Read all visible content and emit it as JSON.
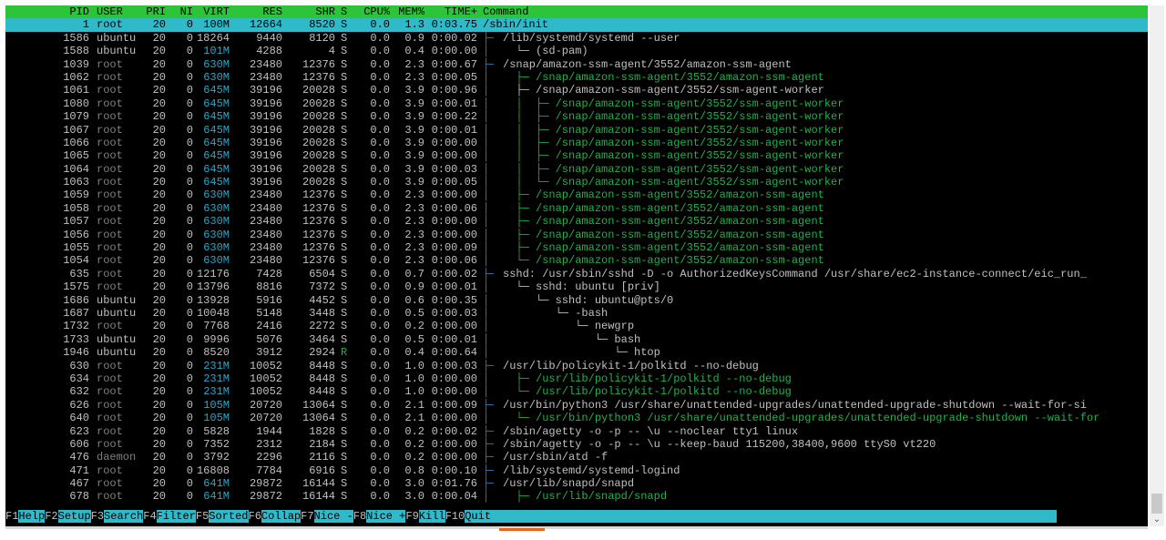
{
  "header": {
    "pid": "PID",
    "user": "USER",
    "pri": "PRI",
    "ni": "NI",
    "virt": "VIRT",
    "res": "RES",
    "shr": "SHR",
    "s": "S",
    "cpu": "CPU%",
    "mem": "MEM%",
    "time": "TIME+",
    "command": "Command"
  },
  "processes": [
    {
      "pid": "1",
      "user": "root",
      "pri": "20",
      "ni": "0",
      "virt": "100M",
      "res": "12664",
      "shr": "8520",
      "s": "S",
      "cpu": "0.0",
      "mem": "1.3",
      "time": "0:03.75",
      "tree": "",
      "command": "/sbin/init",
      "selected": true
    },
    {
      "pid": "1586",
      "user": "ubuntu",
      "pri": "20",
      "ni": "0",
      "virt": "18264",
      "res": "9440",
      "shr": "8120",
      "s": "S",
      "cpu": "0.0",
      "mem": "0.9",
      "time": "0:00.02",
      "tree": "├─",
      "command": "/lib/systemd/systemd --user"
    },
    {
      "pid": "1588",
      "user": "ubuntu",
      "pri": "20",
      "ni": "0",
      "virt": "101M",
      "res": "4288",
      "shr": "4",
      "s": "S",
      "cpu": "0.0",
      "mem": "0.4",
      "time": "0:00.00",
      "tree": "│",
      "command": "  └─ (sd-pam)"
    },
    {
      "pid": "1039",
      "user": "root",
      "pri": "20",
      "ni": "0",
      "virt": "630M",
      "res": "23480",
      "shr": "12376",
      "s": "S",
      "cpu": "0.0",
      "mem": "2.3",
      "time": "0:00.67",
      "tree": "├─",
      "command": "/snap/amazon-ssm-agent/3552/amazon-ssm-agent"
    },
    {
      "pid": "1062",
      "user": "root",
      "pri": "20",
      "ni": "0",
      "virt": "630M",
      "res": "23480",
      "shr": "12376",
      "s": "S",
      "cpu": "0.0",
      "mem": "2.3",
      "time": "0:00.05",
      "tree": "│",
      "command": "  ├─ /snap/amazon-ssm-agent/3552/amazon-ssm-agent",
      "thread": true
    },
    {
      "pid": "1061",
      "user": "root",
      "pri": "20",
      "ni": "0",
      "virt": "645M",
      "res": "39196",
      "shr": "20028",
      "s": "S",
      "cpu": "0.0",
      "mem": "3.9",
      "time": "0:00.96",
      "tree": "│",
      "command": "  ├─ /snap/amazon-ssm-agent/3552/ssm-agent-worker"
    },
    {
      "pid": "1080",
      "user": "root",
      "pri": "20",
      "ni": "0",
      "virt": "645M",
      "res": "39196",
      "shr": "20028",
      "s": "S",
      "cpu": "0.0",
      "mem": "3.9",
      "time": "0:00.01",
      "tree": "│",
      "command": "  │  ├─ /snap/amazon-ssm-agent/3552/ssm-agent-worker",
      "thread": true
    },
    {
      "pid": "1079",
      "user": "root",
      "pri": "20",
      "ni": "0",
      "virt": "645M",
      "res": "39196",
      "shr": "20028",
      "s": "S",
      "cpu": "0.0",
      "mem": "3.9",
      "time": "0:00.22",
      "tree": "│",
      "command": "  │  ├─ /snap/amazon-ssm-agent/3552/ssm-agent-worker",
      "thread": true
    },
    {
      "pid": "1067",
      "user": "root",
      "pri": "20",
      "ni": "0",
      "virt": "645M",
      "res": "39196",
      "shr": "20028",
      "s": "S",
      "cpu": "0.0",
      "mem": "3.9",
      "time": "0:00.01",
      "tree": "│",
      "command": "  │  ├─ /snap/amazon-ssm-agent/3552/ssm-agent-worker",
      "thread": true
    },
    {
      "pid": "1066",
      "user": "root",
      "pri": "20",
      "ni": "0",
      "virt": "645M",
      "res": "39196",
      "shr": "20028",
      "s": "S",
      "cpu": "0.0",
      "mem": "3.9",
      "time": "0:00.00",
      "tree": "│",
      "command": "  │  ├─ /snap/amazon-ssm-agent/3552/ssm-agent-worker",
      "thread": true
    },
    {
      "pid": "1065",
      "user": "root",
      "pri": "20",
      "ni": "0",
      "virt": "645M",
      "res": "39196",
      "shr": "20028",
      "s": "S",
      "cpu": "0.0",
      "mem": "3.9",
      "time": "0:00.00",
      "tree": "│",
      "command": "  │  ├─ /snap/amazon-ssm-agent/3552/ssm-agent-worker",
      "thread": true
    },
    {
      "pid": "1064",
      "user": "root",
      "pri": "20",
      "ni": "0",
      "virt": "645M",
      "res": "39196",
      "shr": "20028",
      "s": "S",
      "cpu": "0.0",
      "mem": "3.9",
      "time": "0:00.03",
      "tree": "│",
      "command": "  │  ├─ /snap/amazon-ssm-agent/3552/ssm-agent-worker",
      "thread": true
    },
    {
      "pid": "1063",
      "user": "root",
      "pri": "20",
      "ni": "0",
      "virt": "645M",
      "res": "39196",
      "shr": "20028",
      "s": "S",
      "cpu": "0.0",
      "mem": "3.9",
      "time": "0:00.05",
      "tree": "│",
      "command": "  │  └─ /snap/amazon-ssm-agent/3552/ssm-agent-worker",
      "thread": true
    },
    {
      "pid": "1059",
      "user": "root",
      "pri": "20",
      "ni": "0",
      "virt": "630M",
      "res": "23480",
      "shr": "12376",
      "s": "S",
      "cpu": "0.0",
      "mem": "2.3",
      "time": "0:00.00",
      "tree": "│",
      "command": "  ├─ /snap/amazon-ssm-agent/3552/amazon-ssm-agent",
      "thread": true
    },
    {
      "pid": "1058",
      "user": "root",
      "pri": "20",
      "ni": "0",
      "virt": "630M",
      "res": "23480",
      "shr": "12376",
      "s": "S",
      "cpu": "0.0",
      "mem": "2.3",
      "time": "0:00.06",
      "tree": "│",
      "command": "  ├─ /snap/amazon-ssm-agent/3552/amazon-ssm-agent",
      "thread": true
    },
    {
      "pid": "1057",
      "user": "root",
      "pri": "20",
      "ni": "0",
      "virt": "630M",
      "res": "23480",
      "shr": "12376",
      "s": "S",
      "cpu": "0.0",
      "mem": "2.3",
      "time": "0:00.00",
      "tree": "│",
      "command": "  ├─ /snap/amazon-ssm-agent/3552/amazon-ssm-agent",
      "thread": true
    },
    {
      "pid": "1056",
      "user": "root",
      "pri": "20",
      "ni": "0",
      "virt": "630M",
      "res": "23480",
      "shr": "12376",
      "s": "S",
      "cpu": "0.0",
      "mem": "2.3",
      "time": "0:00.00",
      "tree": "│",
      "command": "  ├─ /snap/amazon-ssm-agent/3552/amazon-ssm-agent",
      "thread": true
    },
    {
      "pid": "1055",
      "user": "root",
      "pri": "20",
      "ni": "0",
      "virt": "630M",
      "res": "23480",
      "shr": "12376",
      "s": "S",
      "cpu": "0.0",
      "mem": "2.3",
      "time": "0:00.09",
      "tree": "│",
      "command": "  ├─ /snap/amazon-ssm-agent/3552/amazon-ssm-agent",
      "thread": true
    },
    {
      "pid": "1054",
      "user": "root",
      "pri": "20",
      "ni": "0",
      "virt": "630M",
      "res": "23480",
      "shr": "12376",
      "s": "S",
      "cpu": "0.0",
      "mem": "2.3",
      "time": "0:00.06",
      "tree": "│",
      "command": "  └─ /snap/amazon-ssm-agent/3552/amazon-ssm-agent",
      "thread": true
    },
    {
      "pid": "635",
      "user": "root",
      "pri": "20",
      "ni": "0",
      "virt": "12176",
      "res": "7428",
      "shr": "6504",
      "s": "S",
      "cpu": "0.0",
      "mem": "0.7",
      "time": "0:00.02",
      "tree": "├─",
      "command": "sshd: /usr/sbin/sshd -D -o AuthorizedKeysCommand /usr/share/ec2-instance-connect/eic_run_"
    },
    {
      "pid": "1575",
      "user": "root",
      "pri": "20",
      "ni": "0",
      "virt": "13796",
      "res": "8816",
      "shr": "7372",
      "s": "S",
      "cpu": "0.0",
      "mem": "0.9",
      "time": "0:00.01",
      "tree": "│",
      "command": "  └─ sshd: ubuntu [priv]"
    },
    {
      "pid": "1686",
      "user": "ubuntu",
      "pri": "20",
      "ni": "0",
      "virt": "13928",
      "res": "5916",
      "shr": "4452",
      "s": "S",
      "cpu": "0.0",
      "mem": "0.6",
      "time": "0:00.35",
      "tree": "│",
      "command": "     └─ sshd: ubuntu@pts/0"
    },
    {
      "pid": "1687",
      "user": "ubuntu",
      "pri": "20",
      "ni": "0",
      "virt": "10048",
      "res": "5148",
      "shr": "3448",
      "s": "S",
      "cpu": "0.0",
      "mem": "0.5",
      "time": "0:00.03",
      "tree": "│",
      "command": "        └─ -bash"
    },
    {
      "pid": "1732",
      "user": "root",
      "pri": "20",
      "ni": "0",
      "virt": "7768",
      "res": "2416",
      "shr": "2272",
      "s": "S",
      "cpu": "0.0",
      "mem": "0.2",
      "time": "0:00.00",
      "tree": "│",
      "command": "           └─ newgrp"
    },
    {
      "pid": "1733",
      "user": "ubuntu",
      "pri": "20",
      "ni": "0",
      "virt": "9996",
      "res": "5076",
      "shr": "3464",
      "s": "S",
      "cpu": "0.0",
      "mem": "0.5",
      "time": "0:00.01",
      "tree": "│",
      "command": "              └─ bash"
    },
    {
      "pid": "1946",
      "user": "ubuntu",
      "pri": "20",
      "ni": "0",
      "virt": "8520",
      "res": "3912",
      "shr": "2924",
      "s": "R",
      "cpu": "0.0",
      "mem": "0.4",
      "time": "0:00.64",
      "tree": "│",
      "command": "                 └─ htop"
    },
    {
      "pid": "630",
      "user": "root",
      "pri": "20",
      "ni": "0",
      "virt": "231M",
      "res": "10052",
      "shr": "8448",
      "s": "S",
      "cpu": "0.0",
      "mem": "1.0",
      "time": "0:00.03",
      "tree": "├─",
      "command": "/usr/lib/policykit-1/polkitd --no-debug"
    },
    {
      "pid": "634",
      "user": "root",
      "pri": "20",
      "ni": "0",
      "virt": "231M",
      "res": "10052",
      "shr": "8448",
      "s": "S",
      "cpu": "0.0",
      "mem": "1.0",
      "time": "0:00.00",
      "tree": "│",
      "command": "  ├─ /usr/lib/policykit-1/polkitd --no-debug",
      "thread": true
    },
    {
      "pid": "632",
      "user": "root",
      "pri": "20",
      "ni": "0",
      "virt": "231M",
      "res": "10052",
      "shr": "8448",
      "s": "S",
      "cpu": "0.0",
      "mem": "1.0",
      "time": "0:00.00",
      "tree": "│",
      "command": "  └─ /usr/lib/policykit-1/polkitd --no-debug",
      "thread": true
    },
    {
      "pid": "626",
      "user": "root",
      "pri": "20",
      "ni": "0",
      "virt": "105M",
      "res": "20720",
      "shr": "13064",
      "s": "S",
      "cpu": "0.0",
      "mem": "2.1",
      "time": "0:00.09",
      "tree": "├─",
      "command": "/usr/bin/python3 /usr/share/unattended-upgrades/unattended-upgrade-shutdown --wait-for-si"
    },
    {
      "pid": "640",
      "user": "root",
      "pri": "20",
      "ni": "0",
      "virt": "105M",
      "res": "20720",
      "shr": "13064",
      "s": "S",
      "cpu": "0.0",
      "mem": "2.1",
      "time": "0:00.00",
      "tree": "│",
      "command": "  └─ /usr/bin/python3 /usr/share/unattended-upgrades/unattended-upgrade-shutdown --wait-for",
      "thread": true
    },
    {
      "pid": "623",
      "user": "root",
      "pri": "20",
      "ni": "0",
      "virt": "5828",
      "res": "1944",
      "shr": "1828",
      "s": "S",
      "cpu": "0.0",
      "mem": "0.2",
      "time": "0:00.02",
      "tree": "├─",
      "command": "/sbin/agetty -o -p -- \\u --noclear tty1 linux"
    },
    {
      "pid": "606",
      "user": "root",
      "pri": "20",
      "ni": "0",
      "virt": "7352",
      "res": "2312",
      "shr": "2184",
      "s": "S",
      "cpu": "0.0",
      "mem": "0.2",
      "time": "0:00.00",
      "tree": "├─",
      "command": "/sbin/agetty -o -p -- \\u --keep-baud 115200,38400,9600 ttyS0 vt220"
    },
    {
      "pid": "476",
      "user": "daemon",
      "pri": "20",
      "ni": "0",
      "virt": "3792",
      "res": "2296",
      "shr": "2116",
      "s": "S",
      "cpu": "0.0",
      "mem": "0.2",
      "time": "0:00.00",
      "tree": "├─",
      "command": "/usr/sbin/atd -f"
    },
    {
      "pid": "471",
      "user": "root",
      "pri": "20",
      "ni": "0",
      "virt": "16808",
      "res": "7784",
      "shr": "6916",
      "s": "S",
      "cpu": "0.0",
      "mem": "0.8",
      "time": "0:00.10",
      "tree": "├─",
      "command": "/lib/systemd/systemd-logind"
    },
    {
      "pid": "467",
      "user": "root",
      "pri": "20",
      "ni": "0",
      "virt": "641M",
      "res": "29872",
      "shr": "16144",
      "s": "S",
      "cpu": "0.0",
      "mem": "3.0",
      "time": "0:01.76",
      "tree": "├─",
      "command": "/usr/lib/snapd/snapd"
    },
    {
      "pid": "678",
      "user": "root",
      "pri": "20",
      "ni": "0",
      "virt": "641M",
      "res": "29872",
      "shr": "16144",
      "s": "S",
      "cpu": "0.0",
      "mem": "3.0",
      "time": "0:00.04",
      "tree": "│",
      "command": "  ├─ /usr/lib/snapd/snapd",
      "thread": true
    }
  ],
  "footer": [
    {
      "key": "F1",
      "label": "Help  "
    },
    {
      "key": "F2",
      "label": "Setup "
    },
    {
      "key": "F3",
      "label": "Search"
    },
    {
      "key": "F4",
      "label": "Filter"
    },
    {
      "key": "F5",
      "label": "Sorted"
    },
    {
      "key": "F6",
      "label": "Collap"
    },
    {
      "key": "F7",
      "label": "Nice -"
    },
    {
      "key": "F8",
      "label": "Nice +"
    },
    {
      "key": "F9",
      "label": "Kill  "
    },
    {
      "key": "F10",
      "label": "Quit"
    }
  ],
  "colors": {
    "header_bg": "#2ec43a",
    "selected_bg": "#30b9c9",
    "thread_text": "#22b14c",
    "tree_lines": "#2a84c8",
    "terminal_bg": "#000000"
  }
}
